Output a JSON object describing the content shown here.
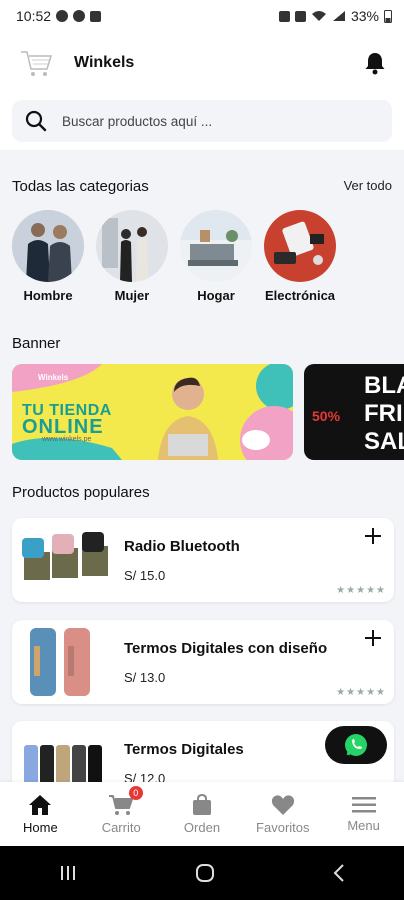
{
  "status": {
    "time": "10:52",
    "battery": "33%"
  },
  "header": {
    "brand": "Winkels"
  },
  "search": {
    "placeholder": "Buscar productos aquí ..."
  },
  "categories": {
    "title": "Todas las categorias",
    "see_all": "Ver todo",
    "items": [
      {
        "label": "Hombre"
      },
      {
        "label": "Mujer"
      },
      {
        "label": "Hogar"
      },
      {
        "label": "Electrónica"
      }
    ]
  },
  "banner": {
    "title": "Banner",
    "items": [
      {
        "tag": "Winkels",
        "line1": "TU TIENDA",
        "line2": "ONLINE",
        "url": "www.winkels.pe"
      },
      {
        "discount": "50%",
        "line1": "BLA",
        "line2": "FRI",
        "line3": "SAL"
      }
    ]
  },
  "popular": {
    "title": "Productos populares",
    "items": [
      {
        "name": "Radio Bluetooth",
        "price": "S/ 15.0"
      },
      {
        "name": "Termos Digitales con diseño",
        "price": "S/ 13.0"
      },
      {
        "name": "Termos Digitales",
        "price": "S/ 12.0"
      }
    ]
  },
  "nav": {
    "cart_count": "0",
    "items": [
      {
        "label": "Home"
      },
      {
        "label": "Carrito"
      },
      {
        "label": "Orden"
      },
      {
        "label": "Favoritos"
      },
      {
        "label": "Menu"
      }
    ]
  },
  "colors": {
    "accent": "#111111",
    "badge": "#e53935",
    "whatsapp": "#25D366",
    "background": "#f2f4f8"
  }
}
